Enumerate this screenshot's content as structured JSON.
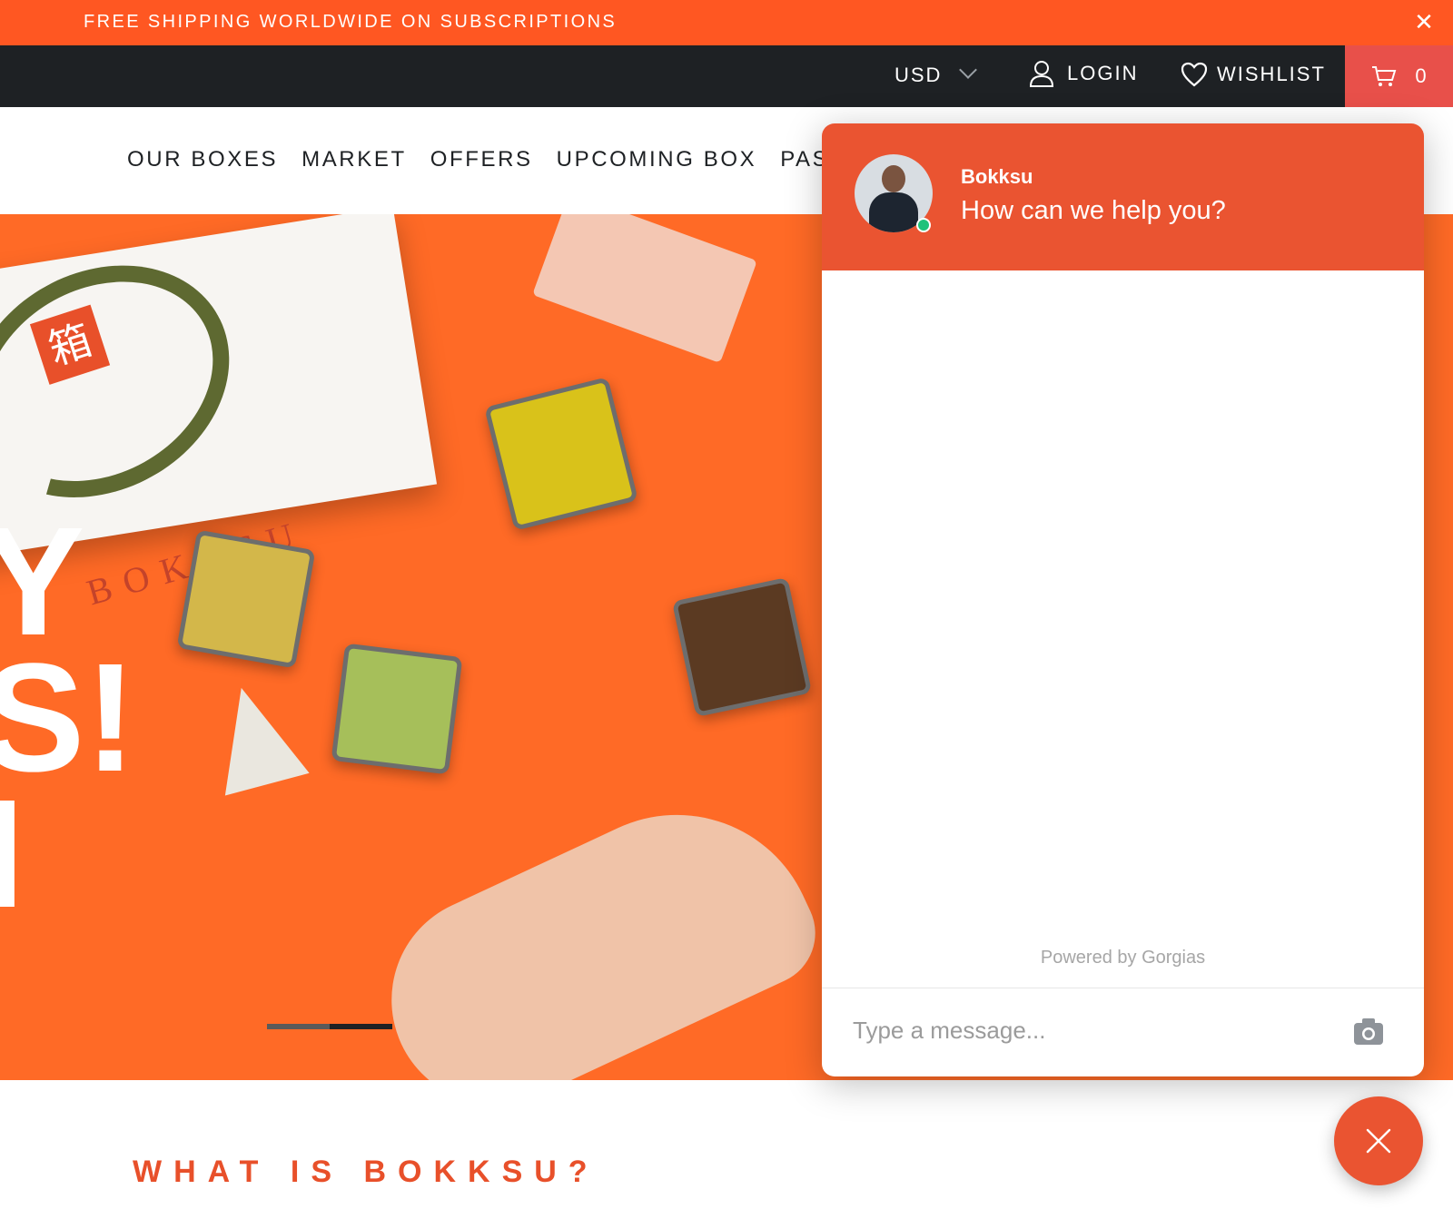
{
  "announcement": {
    "text": "FREE SHIPPING WORLDWIDE ON SUBSCRIPTIONS",
    "close": "✕"
  },
  "topbar": {
    "currency": "USD",
    "login": "LOGIN",
    "wishlist": "WISHLIST",
    "cart_count": "0"
  },
  "nav": [
    "OUR BOXES",
    "MARKET",
    "OFFERS",
    "UPCOMING BOX",
    "PAST"
  ],
  "hero": {
    "brand_kanji": "箱",
    "brand_text": "BOKKSU",
    "big_text": "Y\nS!\nI",
    "slides_total": 2,
    "active_slide": 2
  },
  "section": {
    "heading": "WHAT IS BOKKSU?"
  },
  "chat": {
    "agent_name": "Bokksu",
    "greeting": "How can we help you?",
    "powered_by": "Powered by Gorgias",
    "input_placeholder": "Type a message..."
  },
  "colors": {
    "accent": "#ff5722",
    "chat_header": "#ea5431",
    "topbar": "#1e2124",
    "cart": "#e8504a",
    "online": "#20c27a"
  },
  "icons": [
    "close-icon",
    "chevron-down-icon",
    "user-icon",
    "heart-icon",
    "cart-icon",
    "camera-icon"
  ]
}
